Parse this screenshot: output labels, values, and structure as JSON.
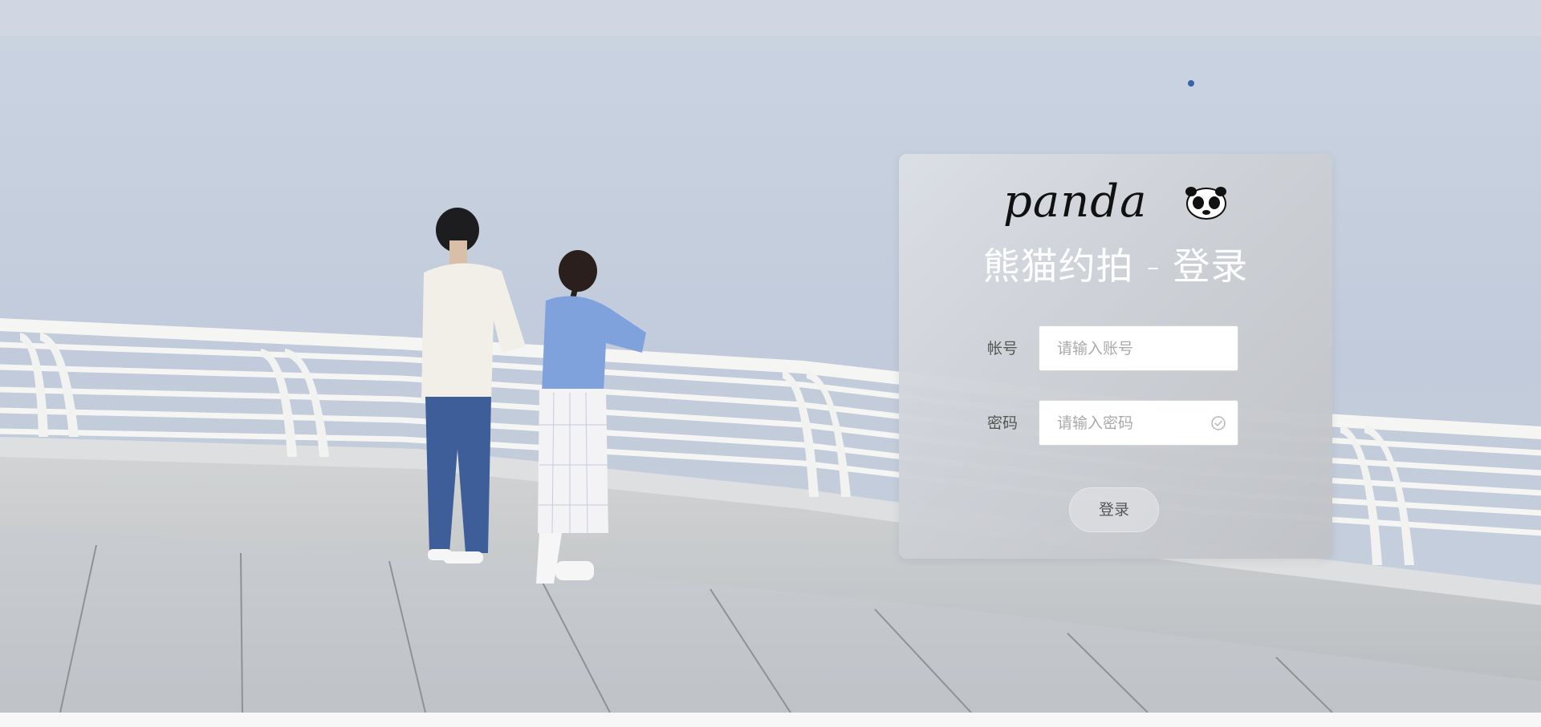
{
  "background": {
    "description_colors": {
      "sky": "#c9d3e2",
      "sea": "#bcc8da",
      "railing": "#f4f4f2",
      "wall": "#c9cbcc",
      "ground": "#c5c8cb"
    }
  },
  "login": {
    "logo_text": "panda",
    "logo_icon": "panda-face-icon",
    "title": "熊猫约拍 - 登录",
    "account": {
      "label": "帐号",
      "placeholder": "请输入账号",
      "value": ""
    },
    "password": {
      "label": "密码",
      "placeholder": "请输入密码",
      "value": "",
      "status_icon": "check-circle-icon"
    },
    "submit_label": "登录"
  }
}
